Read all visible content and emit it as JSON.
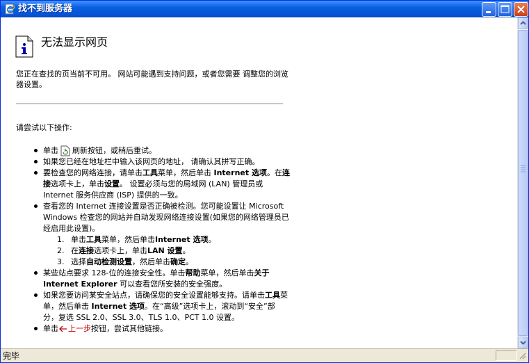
{
  "window": {
    "title": "找不到服务器"
  },
  "page": {
    "title": "无法显示网页",
    "intro": "您正在查找的页当前不可用。 网站可能遇到支持问题，或者您需要 调整您的浏览器设置。",
    "try_heading": "请尝试以下操作:",
    "tip1": {
      "a": "单击",
      "b": "刷新按钮，或稍后重试。"
    },
    "tip2": "如果您已经在地址栏中输入该网页的地址， 请确认其拼写正确。",
    "tip3": {
      "a": "要检查您的网络连接，请单击",
      "b": "工具",
      "c": "菜单，然后单击 ",
      "d": "Internet 选项",
      "e": "。在",
      "f": "连接",
      "g": "选项卡上，单击",
      "h": "设置",
      "i": "。 设置必须与您的局域网 (LAN) 管理员或 Internet 服务供应商 (ISP) 提供的一致。"
    },
    "tip4": {
      "text": "查看您的 Internet 连接设置是否正确被检测。您可能设置让 Microsoft Windows 检查您的网站并自动发现网络连接设置(如果您的网络管理员已经启用此设置)。",
      "steps": [
        {
          "n": "1.",
          "a": "单击",
          "b": "工具",
          "c": "菜单，然后单击",
          "d": "Internet 选项",
          "e": "。"
        },
        {
          "n": "2.",
          "a": "在",
          "b": "连接",
          "c": "选项卡上，单击",
          "d": "LAN 设置",
          "e": "。"
        },
        {
          "n": "3.",
          "a": "选择",
          "b": "自动检测设置",
          "c": "，然后单击",
          "d": "确定",
          "e": "。"
        }
      ]
    },
    "tip5": {
      "a": "某些站点要求 128-位的连接安全性。单击",
      "b": "帮助",
      "c": "菜单，然后单击",
      "d": "关于 Internet Explorer",
      "e": " 可以查看您所安装的安全强度。"
    },
    "tip6": {
      "a": "如果您要访问某安全站点，请确保您的安全设置能够支持。请单击",
      "b": "工具",
      "c": "菜单，然后单击 ",
      "d": "Internet 选项",
      "e": "。在“高级”选项卡上，滚动到“安全”部分，复选 SSL 2.0、SSL 3.0、TLS 1.0、PCT 1.0 设置。"
    },
    "tip7": {
      "a": "单击",
      "link": "上一步",
      "b": "按钮，尝试其他链接。"
    }
  },
  "status": {
    "text": "完毕"
  },
  "icons": {
    "title": "ie-page-icon",
    "info": "info-icon",
    "refresh": "refresh-icon",
    "back": "back-arrow-icon"
  }
}
